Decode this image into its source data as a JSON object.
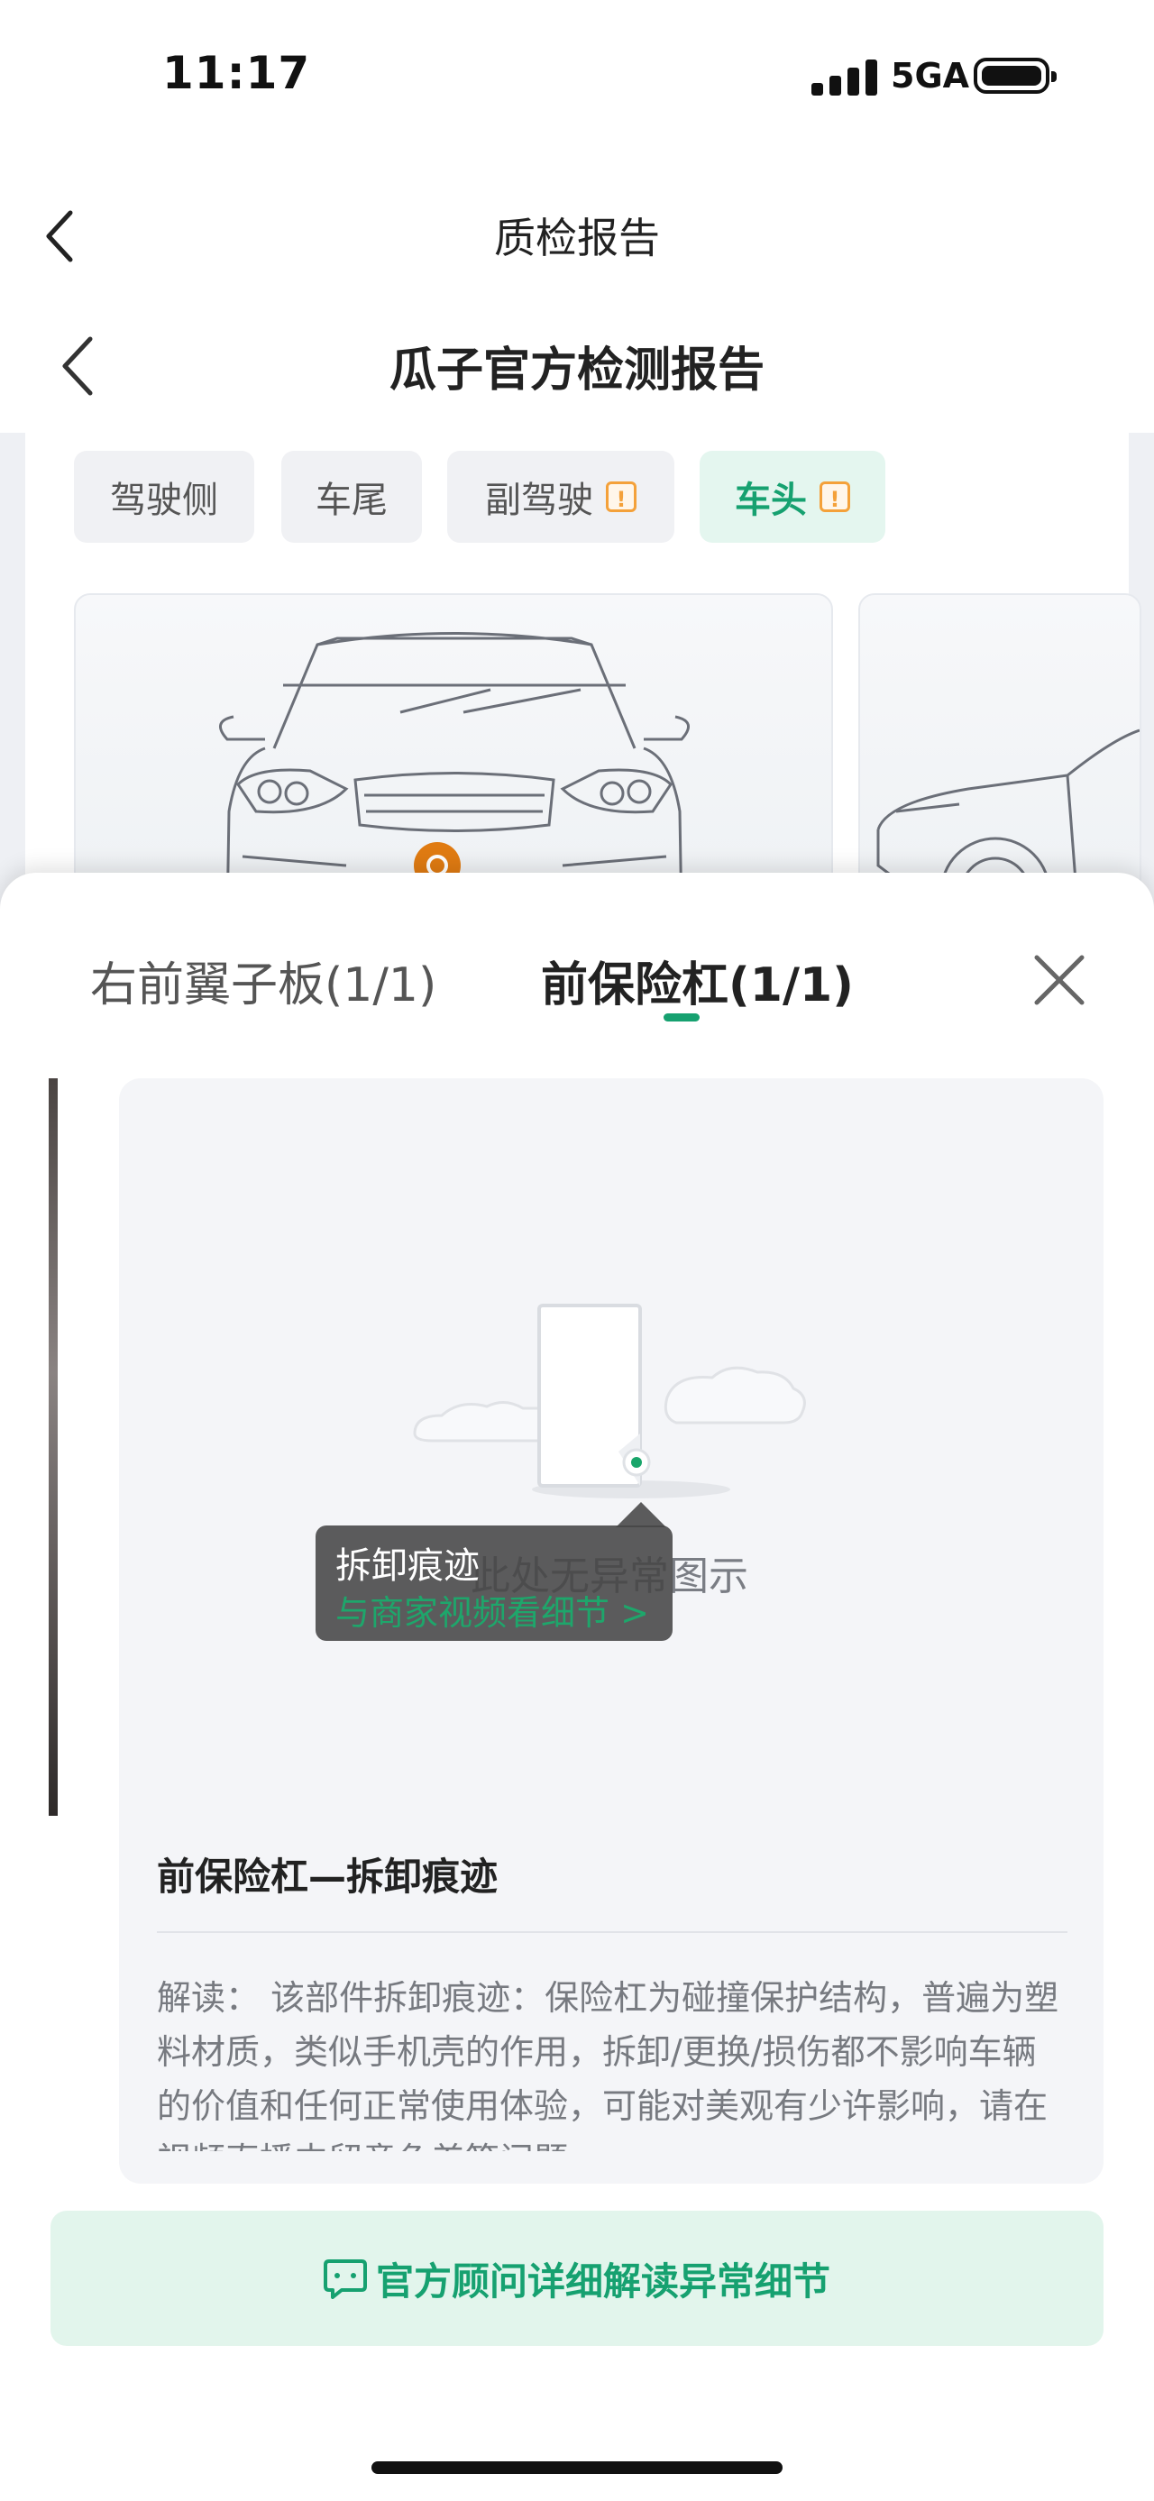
{
  "status_bar": {
    "time": "11:17",
    "network": "5GA"
  },
  "nav": {
    "title": "质检报告"
  },
  "report_header": {
    "title": "瓜子官方检测报告"
  },
  "view_tabs": [
    {
      "label": "驾驶侧",
      "warning": false
    },
    {
      "label": "车尾",
      "warning": false
    },
    {
      "label": "副驾驶",
      "warning": true,
      "warning_mark": "!"
    },
    {
      "label": "车头",
      "warning": true,
      "warning_mark": "!",
      "active": true
    }
  ],
  "sheet": {
    "tabs": [
      {
        "label": "右前翼子板(1/1)",
        "active": false
      },
      {
        "label": "前保险杠(1/1)",
        "active": true
      }
    ],
    "empty_text": "此处无异常图示",
    "tooltip": {
      "title": "拆卸痕迹",
      "link": "与商家视频看细节 >"
    },
    "item_title": "前保险杠—拆卸痕迹",
    "description": "解读： 该部件拆卸痕迹：保险杠为碰撞保护结构，普遍为塑料材质，类似手机壳的作用，拆卸/更换/损伤都不影响车辆的价值和任何正常使用体验，可能对美观有少许影响，请在视频直播中留意色差等问题",
    "cta_label": "官方顾问详细解读异常细节"
  },
  "colors": {
    "accent": "#16a170",
    "warning": "#f4a13a",
    "marker": "#e07b12"
  }
}
